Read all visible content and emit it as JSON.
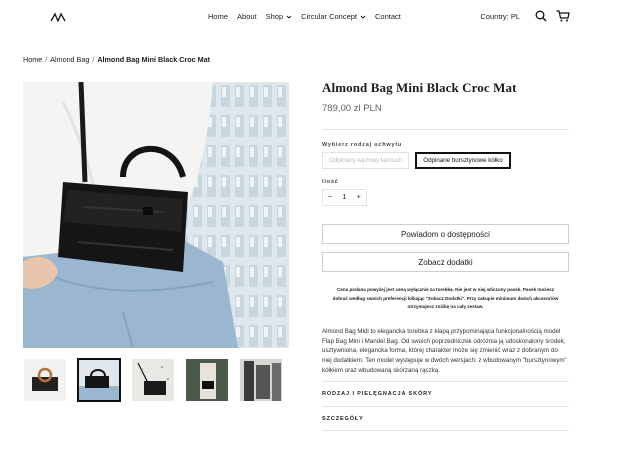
{
  "header": {
    "nav": [
      {
        "label": "Home"
      },
      {
        "label": "About"
      },
      {
        "label": "Shop",
        "dropdown": true
      },
      {
        "label": "Circular Concept",
        "dropdown": true
      },
      {
        "label": "Contact"
      }
    ],
    "country_label": "Country: PL"
  },
  "breadcrumb": {
    "items": [
      "Home",
      "Almond Bag"
    ],
    "current": "Almond Bag Mini Black Croc Mat"
  },
  "product": {
    "title": "Almond Bag Mini Black Croc Mat",
    "price": "789,00 zl PLN",
    "option_label": "Wybierz rodzaj uchwytu",
    "variants": [
      "Odpinany wężowy łańcuch",
      "Odpinane bursztynowe kółko"
    ],
    "selected_variant_index": 1,
    "qty_label": "Ilość",
    "qty_minus": "−",
    "qty_value": "1",
    "qty_plus": "+",
    "notify_button": "Powiadom o dostępności",
    "addons_button": "Zobacz dodatki",
    "note": "Cena podana powyżej jest ceną wyłącznie za torebkę. Nie jest w niej wliczony pasek. Pasek możesz dobrać według swoich preferencji klikając \"Zobacz Dodatki\". Przy zakupie minimum dwóch akcesoriów otrzymujesz zniżkę na cały zestaw.",
    "description": "Almond Bag Midi to elegancka torebka z klapą przypominająca funkcjonalnością model Flap Bag Mini i Mandel Bag. Od swoich poprzedniczek odróżnia ją udoskonalony środek, usztywniona, elegancka forma, której charakter może się zmienić wraz z dobranym do niej dodatkiem. Ten model występuje w dwóch wersjach: z wbudowanym \"bursztynowym\" kółkiem oraz wbudowaną skórzaną rączką.",
    "accordion": [
      "Rodzaj i pielęgnacja skóry",
      "Szczegóły"
    ]
  },
  "colors": {
    "accent": "#111111",
    "border": "#e3e3e3"
  },
  "thumbnails": [
    "thumb-1",
    "thumb-2",
    "thumb-3",
    "thumb-4",
    "thumb-5"
  ],
  "active_thumbnail_index": 1
}
